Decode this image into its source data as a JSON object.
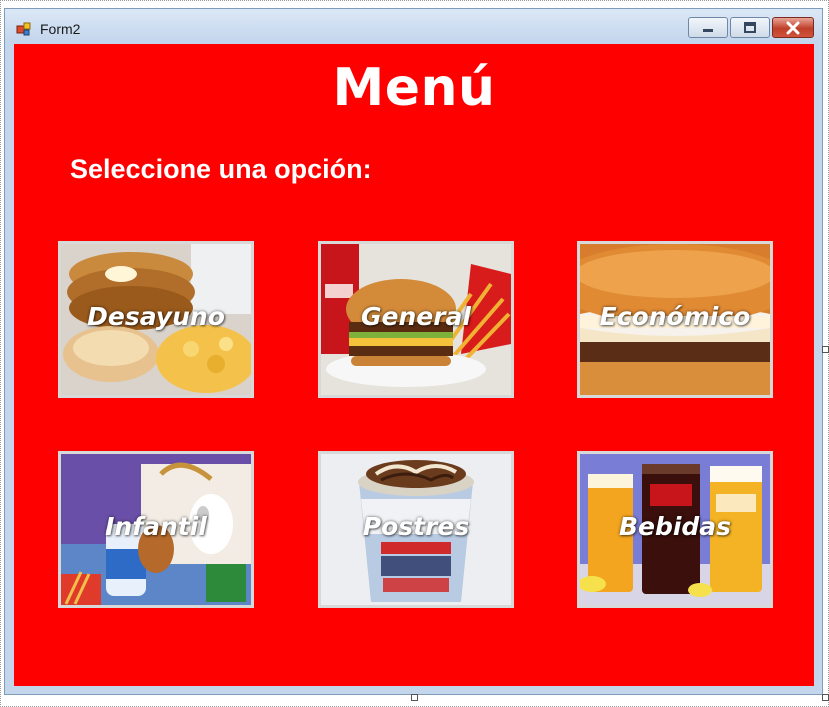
{
  "window": {
    "title": "Form2",
    "icon": "winforms-form-icon",
    "buttons": [
      "minimize-button",
      "maximize-button",
      "close-button"
    ]
  },
  "main": {
    "heading": "Menú",
    "subtitle": "Seleccione una opción:",
    "background_color": "#ff0000",
    "options": [
      {
        "label": "Desayuno",
        "image": "pancakes-breakfast"
      },
      {
        "label": "General",
        "image": "burger-and-fries"
      },
      {
        "label": "Económico",
        "image": "hamburger-closeup"
      },
      {
        "label": "Infantil",
        "image": "kids-meal"
      },
      {
        "label": "Postres",
        "image": "mcflurry-dessert"
      },
      {
        "label": "Bebidas",
        "image": "drinks-glasses"
      }
    ]
  }
}
